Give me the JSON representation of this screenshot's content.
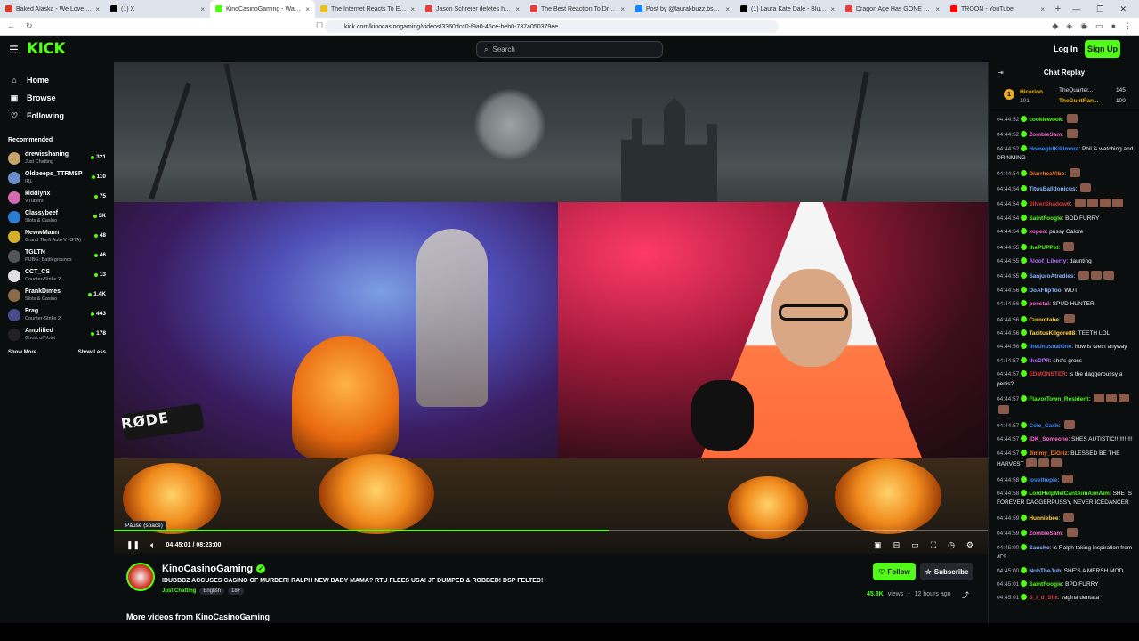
{
  "browser": {
    "tabs": [
      {
        "label": "Baked Alaska - We Love Our McDo",
        "color": "#d43b2a",
        "active": false
      },
      {
        "label": "(1) X",
        "color": "#000000",
        "active": false
      },
      {
        "label": "KinoCasinoGaming - Watch",
        "color": "#53fc18",
        "active": true
      },
      {
        "label": "The Internet Reacts To Electronic A",
        "color": "#e8c020",
        "active": false
      },
      {
        "label": "Jason Schreier deletes his post abo",
        "color": "#e04040",
        "active": false
      },
      {
        "label": "The Best Reaction To Dragon Age",
        "color": "#e04040",
        "active": false
      },
      {
        "label": "Post by @laurakbuzz.bsky.social",
        "color": "#1185fe",
        "active": false
      },
      {
        "label": "(1) Laura Kate Dale - Bluesky @Lau",
        "color": "#000000",
        "active": false
      },
      {
        "label": "Dragon Age Has GONE BLOKE! (T",
        "color": "#e04040",
        "active": false
      },
      {
        "label": "TROON - YouTube",
        "color": "#ff0000",
        "active": false
      }
    ],
    "url": "kick.com/kinocasinogaming/videos/3360dcc0-f9a0-45ce-beb0-737a050379ee"
  },
  "header": {
    "logo": "KICK",
    "search_placeholder": "Search",
    "login": "Log In",
    "signup": "Sign Up"
  },
  "sidebar": {
    "nav": [
      {
        "label": "Home",
        "icon": "home-icon"
      },
      {
        "label": "Browse",
        "icon": "browse-icon"
      },
      {
        "label": "Following",
        "icon": "heart-icon"
      }
    ],
    "recommended_title": "Recommended",
    "channels": [
      {
        "name": "drewisshaning",
        "category": "Just Chatting",
        "viewers": "321",
        "color": "#c7a26a"
      },
      {
        "name": "Oldpeeps_TTRMSP",
        "category": "IRL",
        "viewers": "110",
        "color": "#6a8fc7"
      },
      {
        "name": "kiddlynx",
        "category": "VTubers",
        "viewers": "75",
        "color": "#d46ab0"
      },
      {
        "name": "Classybeef",
        "category": "Slots & Casino",
        "viewers": "3K",
        "color": "#2a7fd4"
      },
      {
        "name": "NewwMann",
        "category": "Grand Theft Auto V (GTA)",
        "viewers": "48",
        "color": "#d4b02a"
      },
      {
        "name": "TGLTN",
        "category": "PUBG: Battlegrounds",
        "viewers": "46",
        "color": "#555555"
      },
      {
        "name": "CCT_CS",
        "category": "Counter-Strike 2",
        "viewers": "13",
        "color": "#e0e0e0"
      },
      {
        "name": "FrankDimes",
        "category": "Slots & Casino",
        "viewers": "1.4K",
        "color": "#8a6a4a"
      },
      {
        "name": "Frag",
        "category": "Counter-Strike 2",
        "viewers": "443",
        "color": "#4a4a8a"
      },
      {
        "name": "Amplified",
        "category": "Ghost of Yotei",
        "viewers": "178",
        "color": "#222222"
      }
    ],
    "show_more": "Show More",
    "show_less": "Show Less"
  },
  "player": {
    "tooltip": "Pause (space)",
    "current_time": "04:45:01",
    "duration": "08:23:00",
    "progress": 0.566
  },
  "stream": {
    "channel": "KinoCasinoGaming",
    "title": "IDUBBBZ ACCUSES CASINO OF MURDER! RALPH NEW BABY MAMA? RTU FLEES USA! JF DUMPED & ROBBED! DSP FELTED!",
    "category": "Just Chatting",
    "tags": [
      "English",
      "18+"
    ],
    "follow": "Follow",
    "subscribe": "Subscribe",
    "views": "45.8K",
    "views_label": "views",
    "age": "12 hours ago",
    "more_videos": "More videos from KinoCasinoGaming"
  },
  "chat": {
    "title": "Chat Replay",
    "pinned": {
      "top1": "Hicerion",
      "top1_count": "191",
      "top2": "TheQuarter...",
      "top2_count": "145",
      "top3": "TheGuntRan...",
      "top3_count": "100"
    },
    "messages": [
      {
        "time": "04:44:52",
        "user": "cookiewook",
        "color": "#53fc18",
        "text": "",
        "emotes": 1
      },
      {
        "time": "04:44:52",
        "user": "ZombieSam",
        "color": "#ff6ad5",
        "text": "",
        "emotes": 1
      },
      {
        "time": "04:44:52",
        "user": "HomegirlKikimora",
        "color": "#3f8cff",
        "text": "Phil is watching and DRINMING",
        "emotes": 0
      },
      {
        "time": "04:44:54",
        "user": "DiarrheaVibe",
        "color": "#ff7a2a",
        "text": "",
        "emotes": 1
      },
      {
        "time": "04:44:54",
        "user": "TitusBalldonicus",
        "color": "#8ab4ff",
        "text": "",
        "emotes": 1
      },
      {
        "time": "04:44:54",
        "user": "SilverShadow6",
        "color": "#e03a3a",
        "text": "",
        "emotes": 4
      },
      {
        "time": "04:44:54",
        "user": "SaintFoogle",
        "color": "#53fc18",
        "text": "BOD FURRY",
        "emotes": 0
      },
      {
        "time": "04:44:54",
        "user": "xopeo",
        "color": "#ff6ad5",
        "text": "pussy Galore",
        "emotes": 0
      },
      {
        "time": "04:44:55",
        "user": "thePUPPet",
        "color": "#53fc18",
        "text": "",
        "emotes": 1
      },
      {
        "time": "04:44:55",
        "user": "Aloof_Liberty",
        "color": "#b36aff",
        "text": "daunting",
        "emotes": 0
      },
      {
        "time": "04:44:55",
        "user": "SanjuroAtredies",
        "color": "#8ab4ff",
        "text": "",
        "emotes": 3
      },
      {
        "time": "04:44:56",
        "user": "DoAFlipToo",
        "color": "#8ab4ff",
        "text": "WUT",
        "emotes": 0
      },
      {
        "time": "04:44:56",
        "user": "poestal",
        "color": "#ff6ad5",
        "text": "SPUD HUNTER",
        "emotes": 0
      },
      {
        "time": "04:44:56",
        "user": "Cuuvotabe",
        "color": "#ffd24a",
        "text": "",
        "emotes": 1
      },
      {
        "time": "04:44:56",
        "user": "TacitusKilgore88",
        "color": "#ffd24a",
        "text": "TEETH LOL",
        "emotes": 0
      },
      {
        "time": "04:44:56",
        "user": "theUnusualOne",
        "color": "#3f8cff",
        "text": "how is teeth anyway",
        "emotes": 0
      },
      {
        "time": "04:44:57",
        "user": "theDPR",
        "color": "#b36aff",
        "text": "she's gross",
        "emotes": 0
      },
      {
        "time": "04:44:57",
        "user": "EDMONSTER",
        "color": "#e03a3a",
        "text": "is the daggerpussy a penis?",
        "emotes": 0
      },
      {
        "time": "04:44:57",
        "user": "FlavorTown_Resident",
        "color": "#53fc18",
        "text": "",
        "emotes": 4
      },
      {
        "time": "04:44:57",
        "user": "Cole_Cash",
        "color": "#3f8cff",
        "text": "",
        "emotes": 1
      },
      {
        "time": "04:44:57",
        "user": "IDK_Someone",
        "color": "#ff6ad5",
        "text": "SHES AUTISTIC!!!!!!!!!!!",
        "emotes": 0
      },
      {
        "time": "04:44:57",
        "user": "Jimmy_DiGriz",
        "color": "#ff7a2a",
        "text": "BLESSED BE THE HARVEST",
        "emotes": 3
      },
      {
        "time": "04:44:58",
        "user": "lovethepie",
        "color": "#3f8cff",
        "text": "",
        "emotes": 1
      },
      {
        "time": "04:44:58",
        "user": "LordHelpMeICantAimAimAim",
        "color": "#53fc18",
        "text": "SHE IS FOREVER DAGGERPUSSY, NEVER ICEDANCER",
        "emotes": 0
      },
      {
        "time": "04:44:59",
        "user": "Hunniebee",
        "color": "#ffd24a",
        "text": "",
        "emotes": 1
      },
      {
        "time": "04:44:59",
        "user": "ZombieSam",
        "color": "#ff6ad5",
        "text": "",
        "emotes": 1
      },
      {
        "time": "04:45:00",
        "user": "Saucho",
        "color": "#8ab4ff",
        "text": "is Ralph taking inspiration from JF?",
        "emotes": 0
      },
      {
        "time": "04:45:00",
        "user": "NubTheJub",
        "color": "#8ab4ff",
        "text": "SHE'S A MERSH MOD",
        "emotes": 0
      },
      {
        "time": "04:45:01",
        "user": "SaintFoogie",
        "color": "#53fc18",
        "text": "BPD FURRY",
        "emotes": 0
      },
      {
        "time": "04:45:01",
        "user": "S_i_d_Slix",
        "color": "#e03a3a",
        "text": "vagina dentata",
        "emotes": 0
      }
    ]
  },
  "colors": {
    "accent": "#53fc18",
    "background": "#0b0e0f"
  }
}
